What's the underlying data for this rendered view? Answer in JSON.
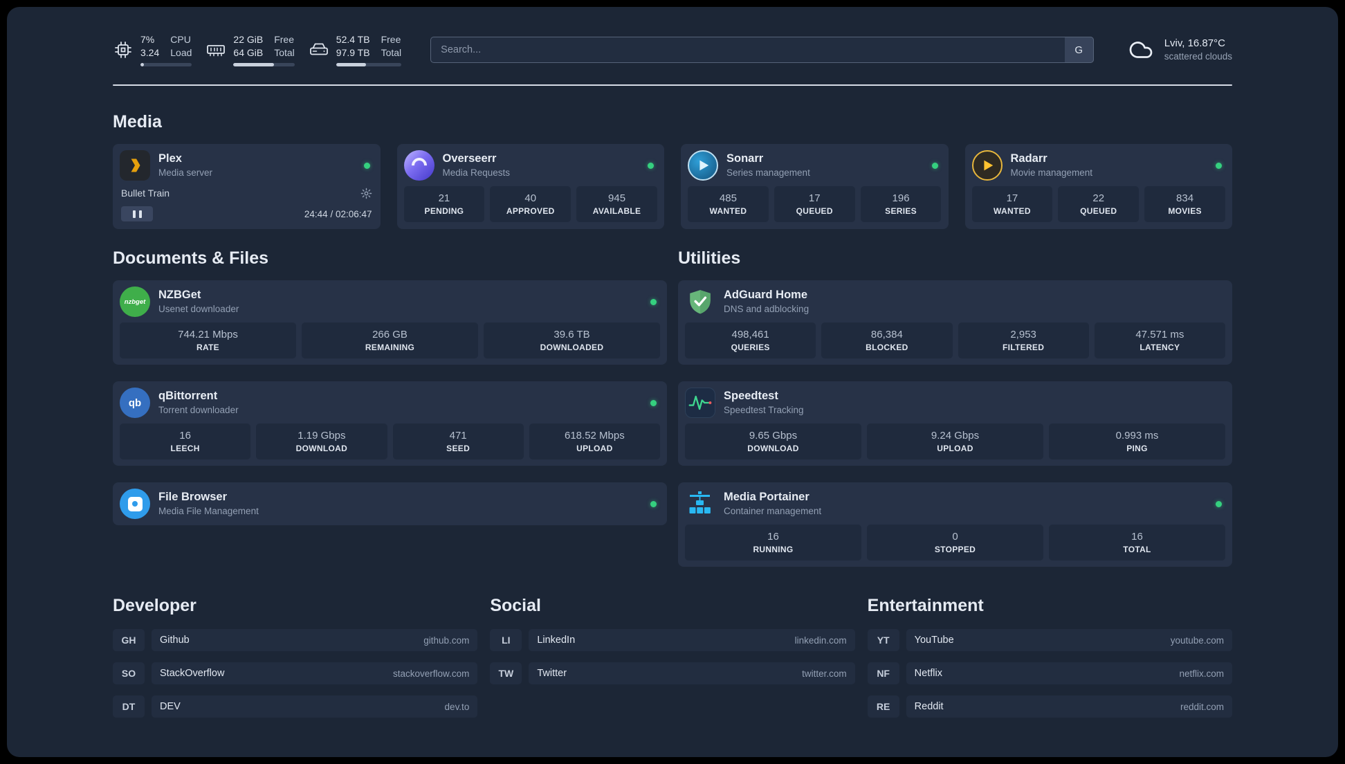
{
  "colors": {
    "background": "#1c2636",
    "card": "#273247",
    "stat_box": "#1f2a3d",
    "status_online": "#35d07f",
    "accent_plex": "#e5a00d",
    "accent_overseerr": "#7b6cf0",
    "accent_sonarr": "#35c5f4",
    "accent_radarr": "#ffc230",
    "accent_nzbget": "#3fae4a",
    "accent_qbittorrent": "#356fc0",
    "accent_filebrowser": "#2f9ceb",
    "accent_adguard": "#67b67a",
    "accent_speedtest": "#3fd68f",
    "accent_portainer": "#29b8f2"
  },
  "topbar": {
    "cpu": {
      "value1": "7%",
      "value2": "3.24",
      "label1": "CPU",
      "label2": "Load",
      "bar_percent": 7
    },
    "memory": {
      "value1": "22 GiB",
      "value2": "64 GiB",
      "label1": "Free",
      "label2": "Total",
      "bar_percent": 66
    },
    "disk": {
      "value1": "52.4 TB",
      "value2": "97.9 TB",
      "label1": "Free",
      "label2": "Total",
      "bar_percent": 46
    },
    "search": {
      "placeholder": "Search...",
      "engine_button": "G"
    },
    "weather": {
      "location": "Lviv, 16.87°C",
      "condition": "scattered clouds"
    }
  },
  "media": {
    "title": "Media",
    "plex": {
      "name": "Plex",
      "sub": "Media server",
      "now_playing": "Bullet Train",
      "time": "24:44 / 02:06:47"
    },
    "overseerr": {
      "name": "Overseerr",
      "sub": "Media Requests",
      "stats": [
        {
          "v": "21",
          "l": "PENDING"
        },
        {
          "v": "40",
          "l": "APPROVED"
        },
        {
          "v": "945",
          "l": "AVAILABLE"
        }
      ]
    },
    "sonarr": {
      "name": "Sonarr",
      "sub": "Series management",
      "stats": [
        {
          "v": "485",
          "l": "WANTED"
        },
        {
          "v": "17",
          "l": "QUEUED"
        },
        {
          "v": "196",
          "l": "SERIES"
        }
      ]
    },
    "radarr": {
      "name": "Radarr",
      "sub": "Movie management",
      "stats": [
        {
          "v": "17",
          "l": "WANTED"
        },
        {
          "v": "22",
          "l": "QUEUED"
        },
        {
          "v": "834",
          "l": "MOVIES"
        }
      ]
    }
  },
  "documents": {
    "title": "Documents & Files",
    "nzbget": {
      "name": "NZBGet",
      "sub": "Usenet downloader",
      "icon_label": "nzbget",
      "stats": [
        {
          "v": "744.21 Mbps",
          "l": "RATE"
        },
        {
          "v": "266 GB",
          "l": "REMAINING"
        },
        {
          "v": "39.6 TB",
          "l": "DOWNLOADED"
        }
      ]
    },
    "qbittorrent": {
      "name": "qBittorrent",
      "sub": "Torrent downloader",
      "icon_label": "qb",
      "stats": [
        {
          "v": "16",
          "l": "LEECH"
        },
        {
          "v": "1.19 Gbps",
          "l": "DOWNLOAD"
        },
        {
          "v": "471",
          "l": "SEED"
        },
        {
          "v": "618.52 Mbps",
          "l": "UPLOAD"
        }
      ]
    },
    "filebrowser": {
      "name": "File Browser",
      "sub": "Media File Management"
    }
  },
  "utilities": {
    "title": "Utilities",
    "adguard": {
      "name": "AdGuard Home",
      "sub": "DNS and adblocking",
      "stats": [
        {
          "v": "498,461",
          "l": "QUERIES"
        },
        {
          "v": "86,384",
          "l": "BLOCKED"
        },
        {
          "v": "2,953",
          "l": "FILTERED"
        },
        {
          "v": "47.571 ms",
          "l": "LATENCY"
        }
      ]
    },
    "speedtest": {
      "name": "Speedtest",
      "sub": "Speedtest Tracking",
      "stats": [
        {
          "v": "9.65 Gbps",
          "l": "DOWNLOAD"
        },
        {
          "v": "9.24 Gbps",
          "l": "UPLOAD"
        },
        {
          "v": "0.993 ms",
          "l": "PING"
        }
      ]
    },
    "portainer": {
      "name": "Media Portainer",
      "sub": "Container management",
      "stats": [
        {
          "v": "16",
          "l": "RUNNING"
        },
        {
          "v": "0",
          "l": "STOPPED"
        },
        {
          "v": "16",
          "l": "TOTAL"
        }
      ]
    }
  },
  "bookmarks": {
    "developer": {
      "title": "Developer",
      "items": [
        {
          "abbr": "GH",
          "name": "Github",
          "url": "github.com"
        },
        {
          "abbr": "SO",
          "name": "StackOverflow",
          "url": "stackoverflow.com"
        },
        {
          "abbr": "DT",
          "name": "DEV",
          "url": "dev.to"
        }
      ]
    },
    "social": {
      "title": "Social",
      "items": [
        {
          "abbr": "LI",
          "name": "LinkedIn",
          "url": "linkedin.com"
        },
        {
          "abbr": "TW",
          "name": "Twitter",
          "url": "twitter.com"
        }
      ]
    },
    "entertainment": {
      "title": "Entertainment",
      "items": [
        {
          "abbr": "YT",
          "name": "YouTube",
          "url": "youtube.com"
        },
        {
          "abbr": "NF",
          "name": "Netflix",
          "url": "netflix.com"
        },
        {
          "abbr": "RE",
          "name": "Reddit",
          "url": "reddit.com"
        }
      ]
    }
  }
}
